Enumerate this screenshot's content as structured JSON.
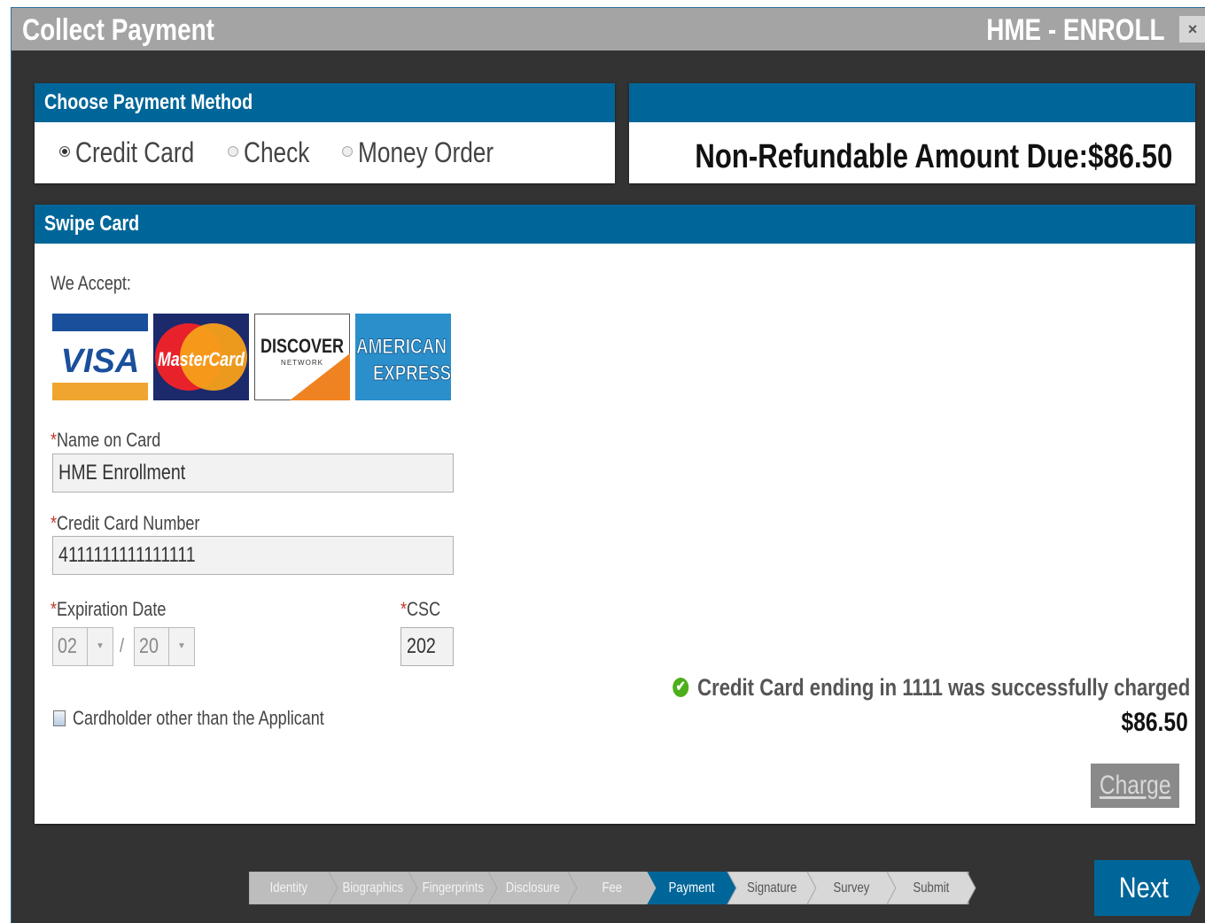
{
  "window": {
    "title": "Collect Payment",
    "brand": "HME - ENROLL",
    "close_label": "×"
  },
  "payment_method": {
    "heading": "Choose Payment Method",
    "options": [
      {
        "label": "Credit Card",
        "selected": true
      },
      {
        "label": "Check",
        "selected": false
      },
      {
        "label": "Money Order",
        "selected": false
      }
    ]
  },
  "amount_due": {
    "label": "Non-Refundable Amount Due:",
    "value": "$86.50"
  },
  "swipe": {
    "heading": "Swipe Card",
    "we_accept": "We Accept:",
    "cards": {
      "visa": "VISA",
      "mastercard": "MasterCard",
      "discover": "DISCOVER",
      "discover_sub": "NETWORK",
      "amex_line1": "AMERICAN",
      "amex_line2": "EXPRESS"
    },
    "required_mark": "*",
    "name_label": "Name on Card",
    "name_value": "HME Enrollment",
    "number_label": "Credit Card Number",
    "number_value": "4111111111111111",
    "exp_label": "Expiration Date",
    "exp_month": "02",
    "exp_sep": "/",
    "exp_year": "20",
    "csc_label": "CSC",
    "csc_value": "202",
    "other_cardholder_label": "Cardholder other than the Applicant",
    "status_message": "Credit Card ending in 1111 was successfully charged",
    "status_amount": "$86.50",
    "charge_label": "Charge"
  },
  "stepper": {
    "steps": [
      "Identity",
      "Biographics",
      "Fingerprints",
      "Disclosure",
      "Fee",
      "Payment",
      "Signature",
      "Survey",
      "Submit"
    ],
    "active": "Payment"
  },
  "next_label": "Next",
  "colors": {
    "header_blue": "#006699",
    "window_dark": "#333333",
    "title_gray": "#a4a4a4",
    "success_green": "#4caf1a"
  }
}
